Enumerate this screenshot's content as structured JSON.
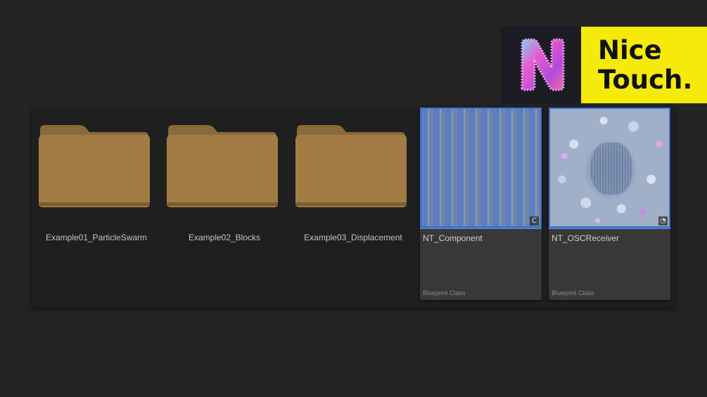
{
  "logo": {
    "letter": "N",
    "line1": "Nice",
    "line2": "Touch."
  },
  "content_browser": {
    "folders": [
      {
        "label": "Example01_ParticleSwarm",
        "icon": "folder-icon"
      },
      {
        "label": "Example02_Blocks",
        "icon": "folder-icon"
      },
      {
        "label": "Example03_Displacement",
        "icon": "folder-icon"
      }
    ],
    "assets": [
      {
        "name": "NT_Component",
        "type": "Blueprint Class",
        "badge": "C",
        "thumbnail": "striped-blue"
      },
      {
        "name": "NT_OSCReceiver",
        "type": "Blueprint Class",
        "badge": "◔",
        "thumbnail": "particle-swirl"
      }
    ]
  },
  "colors": {
    "background": "#242424",
    "panel": "#1f1f1f",
    "folder": "#a27c44",
    "selection_accent": "#4d82d8",
    "logo_yellow": "#f5ea0a"
  }
}
